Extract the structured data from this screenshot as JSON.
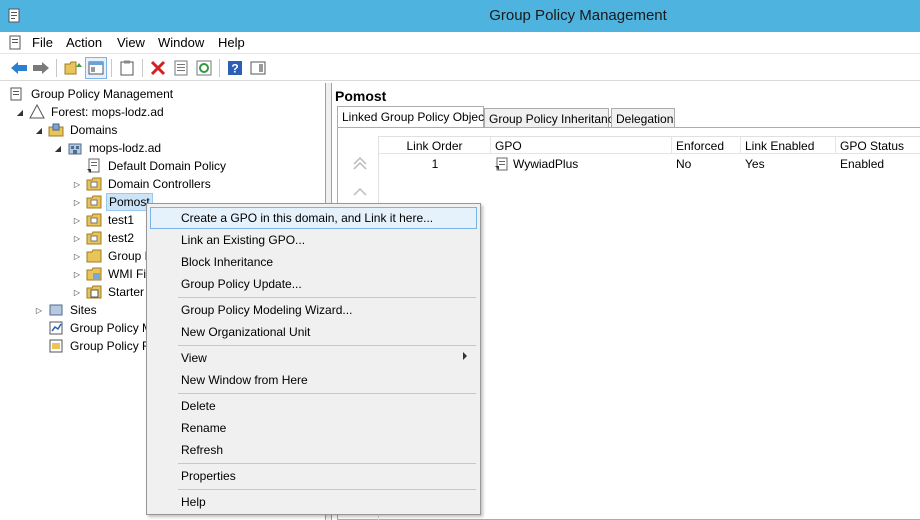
{
  "window": {
    "title": "Group Policy Management"
  },
  "menu": {
    "items": [
      "File",
      "Action",
      "View",
      "Window",
      "Help"
    ]
  },
  "tree": {
    "root": "Group Policy Management",
    "forest": "Forest: mops-lodz.ad",
    "domains": "Domains",
    "domain": "mops-lodz.ad",
    "items": [
      "Default Domain Policy",
      "Domain Controllers",
      "Pomost",
      "test1",
      "test2",
      "Group P",
      "WMI Fi",
      "Starter"
    ],
    "sites": "Sites",
    "modeling": "Group Policy M",
    "results": "Group Policy R"
  },
  "details": {
    "title": "Pomost",
    "tabs": [
      "Linked Group Policy Objects",
      "Group Policy Inheritance",
      "Delegation"
    ],
    "columns": [
      "Link Order",
      "GPO",
      "Enforced",
      "Link Enabled",
      "GPO Status"
    ],
    "rows": [
      {
        "link_order": "1",
        "gpo": "WywiadPlus",
        "enforced": "No",
        "link_enabled": "Yes",
        "gpo_status": "Enabled"
      }
    ]
  },
  "context_menu": {
    "items": [
      "Create a GPO in this domain, and Link it here...",
      "Link an Existing GPO...",
      "Block Inheritance",
      "Group Policy Update...",
      "Group Policy Modeling Wizard...",
      "New Organizational Unit",
      "View",
      "New Window from Here",
      "Delete",
      "Rename",
      "Refresh",
      "Properties",
      "Help"
    ]
  },
  "colors": {
    "titlebar": "#4fb3e0",
    "highlight": "#e5f1fb",
    "selection": "#cce4f7"
  }
}
